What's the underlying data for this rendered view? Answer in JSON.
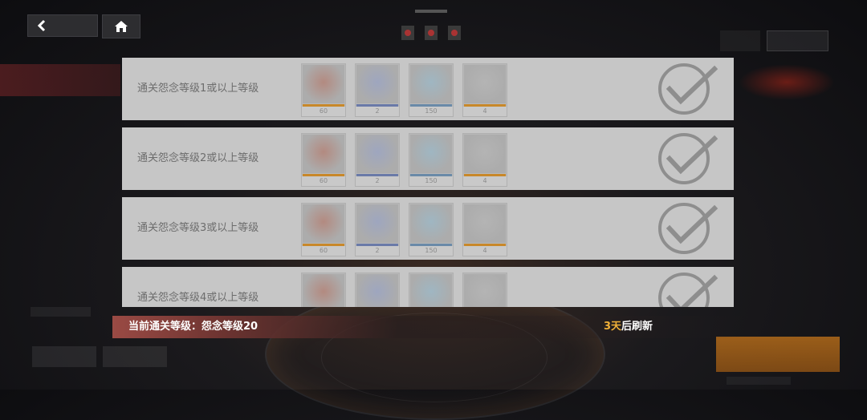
{
  "nav": {
    "back_icon": "chevron-left-icon",
    "home_icon": "home-icon"
  },
  "tasks": [
    {
      "title": "通关怨念等级1或以上等级",
      "completed": true
    },
    {
      "title": "通关怨念等级2或以上等级",
      "completed": true
    },
    {
      "title": "通关怨念等级3或以上等级",
      "completed": true
    },
    {
      "title": "通关怨念等级4或以上等级",
      "completed": true
    }
  ],
  "rewards": [
    {
      "name": "character-shard",
      "count": "60",
      "stripe_color": "#c8882a"
    },
    {
      "name": "blue-orb",
      "count": "2",
      "stripe_color": "#6a7aa8"
    },
    {
      "name": "cyan-crystal",
      "count": "150",
      "stripe_color": "#6a8aa8"
    },
    {
      "name": "feather",
      "count": "4",
      "stripe_color": "#c8882a"
    }
  ],
  "status": {
    "current_level": "当前通关等级：怨念等级20",
    "refresh_days": "3天",
    "refresh_suffix": "后刷新"
  },
  "colors": {
    "row_bg": "#c6c6c6",
    "highlight": "#f0b038",
    "status_bar": "#9a4a44"
  }
}
